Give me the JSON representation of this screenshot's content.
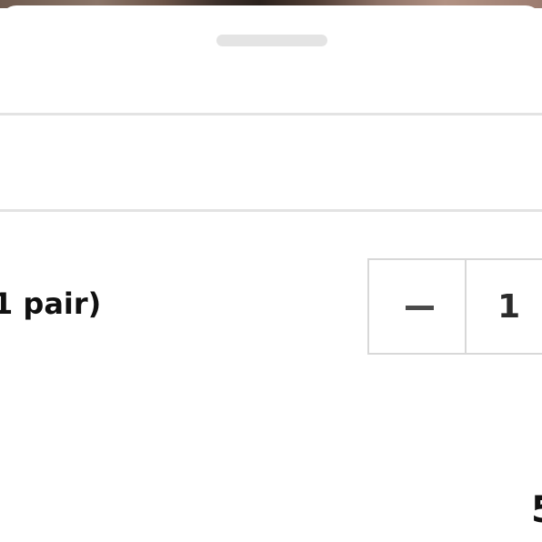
{
  "sheet": {
    "photo_strip_colors": [
      "#6f5b4f",
      "#2c221d",
      "#b29283"
    ],
    "handle_color": "#e4e4e4",
    "divider_color": "#e3e3e3"
  },
  "item": {
    "label": "1 pair)"
  },
  "quantity": {
    "decrement_icon": "minus-icon",
    "value": "1"
  },
  "footer": {
    "price_partial": "5"
  }
}
